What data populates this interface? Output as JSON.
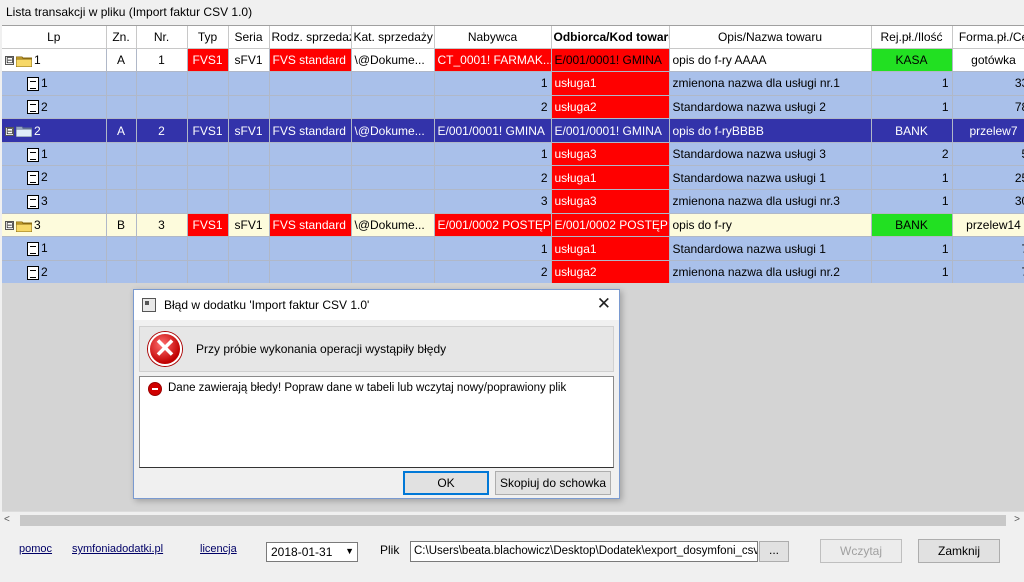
{
  "group_title": "Lista transakcji w pliku (Import faktur CSV 1.0)",
  "columns": [
    "Lp",
    "Zn.",
    "Nr.",
    "Typ",
    "Seria",
    "Rodz. sprzedaży",
    "Kat. sprzedaży",
    "Nabywca",
    "Odbiorca/Kod towaru",
    "Opis/Nazwa towaru",
    "Rej.pł./Ilość",
    "Forma.pł./Ce"
  ],
  "rows": [
    {
      "kind": "parent",
      "lp": "1",
      "zn": "A",
      "nr": "1",
      "typ": "FVS1",
      "seria": "sFV1",
      "rodz": "FVS standard",
      "kat": "\\@Dokume...",
      "nabywca": "CT_0001! FARMAK...",
      "odbiorca": "E/001/0001!  GMINA",
      "opis": "opis do f-ry AAAA",
      "rej": "KASA",
      "forma": "gotówka"
    },
    {
      "kind": "child",
      "lp": "1",
      "nabywca": "1",
      "odbiorca": "usługa1",
      "opis": "zmienona nazwa dla usługi nr.1",
      "rej": "1",
      "forma": "33,"
    },
    {
      "kind": "child",
      "lp": "2",
      "nabywca": "2",
      "odbiorca": "usługa2",
      "opis": "Standardowa nazwa usługi 2",
      "rej": "1",
      "forma": "78,"
    },
    {
      "kind": "parent",
      "lp": "2",
      "zn": "A",
      "nr": "2",
      "typ": "FVS1",
      "seria": "sFV1",
      "rodz": "FVS standard",
      "kat": "\\@Dokume...",
      "nabywca": "E/001/0001!  GMINA",
      "odbiorca": "E/001/0001!  GMINA",
      "opis": "opis do f-ryBBBB",
      "rej": "BANK",
      "forma": "przelew7"
    },
    {
      "kind": "child",
      "lp": "1",
      "nabywca": "1",
      "odbiorca": "usługa3",
      "opis": "Standardowa nazwa usługi 3",
      "rej": "2",
      "forma": "5,"
    },
    {
      "kind": "child",
      "lp": "2",
      "nabywca": "2",
      "odbiorca": "usługa1",
      "opis": "Standardowa nazwa usługi 1",
      "rej": "1",
      "forma": "25,"
    },
    {
      "kind": "child",
      "lp": "3",
      "nabywca": "3",
      "odbiorca": "usługa3",
      "opis": "zmienona nazwa dla usługi nr.3",
      "rej": "1",
      "forma": "30,"
    },
    {
      "kind": "parent",
      "lp": "3",
      "zn": "B",
      "nr": "3",
      "typ": "FVS1",
      "seria": "sFV1",
      "rodz": "FVS standard",
      "kat": "\\@Dokume...",
      "nabywca": "E/001/0002 POSTĘP",
      "odbiorca": "E/001/0002 POSTĘP",
      "opis": "opis do f-ry",
      "rej": "BANK",
      "forma": "przelew14"
    },
    {
      "kind": "child",
      "lp": "1",
      "nabywca": "1",
      "odbiorca": "usługa1",
      "opis": "Standardowa nazwa usługi 1",
      "rej": "1",
      "forma": "7,"
    },
    {
      "kind": "child",
      "lp": "2",
      "nabywca": "2",
      "odbiorca": "usługa2",
      "opis": "zmienona nazwa dla usługi nr.2",
      "rej": "1",
      "forma": "7,"
    }
  ],
  "tree_expanded_glyph": "⊟",
  "scroll": {
    "left_arrow": "<",
    "right_arrow": ">"
  },
  "bottom": {
    "pomoc": "pomoc",
    "symfonia": "symfoniadodatki.pl",
    "licencja": "licencja",
    "date": "2018-01-31",
    "plik_label": "Plik",
    "path": "C:\\Users\\beata.blachowicz\\Desktop\\Dodatek\\export_dosymfoni_csv",
    "browse": "...",
    "wczytaj": "Wczytaj",
    "zamknij": "Zamknij"
  },
  "dialog": {
    "title": "Błąd w dodatku 'Import faktur CSV 1.0'",
    "close": "✕",
    "header": "Przy próbie wykonania operacji wystąpiły błędy",
    "message": "Dane zawierają błedy! Popraw dane w tabeli lub wczytaj nowy/poprawiony plik",
    "ok": "OK",
    "copy": "Skopiuj do schowka"
  },
  "colors": {
    "red": "#ff0000",
    "green": "#22e022",
    "selected": "#3333aa",
    "child": "#a9c0ea",
    "cream": "#fdfbdc"
  }
}
